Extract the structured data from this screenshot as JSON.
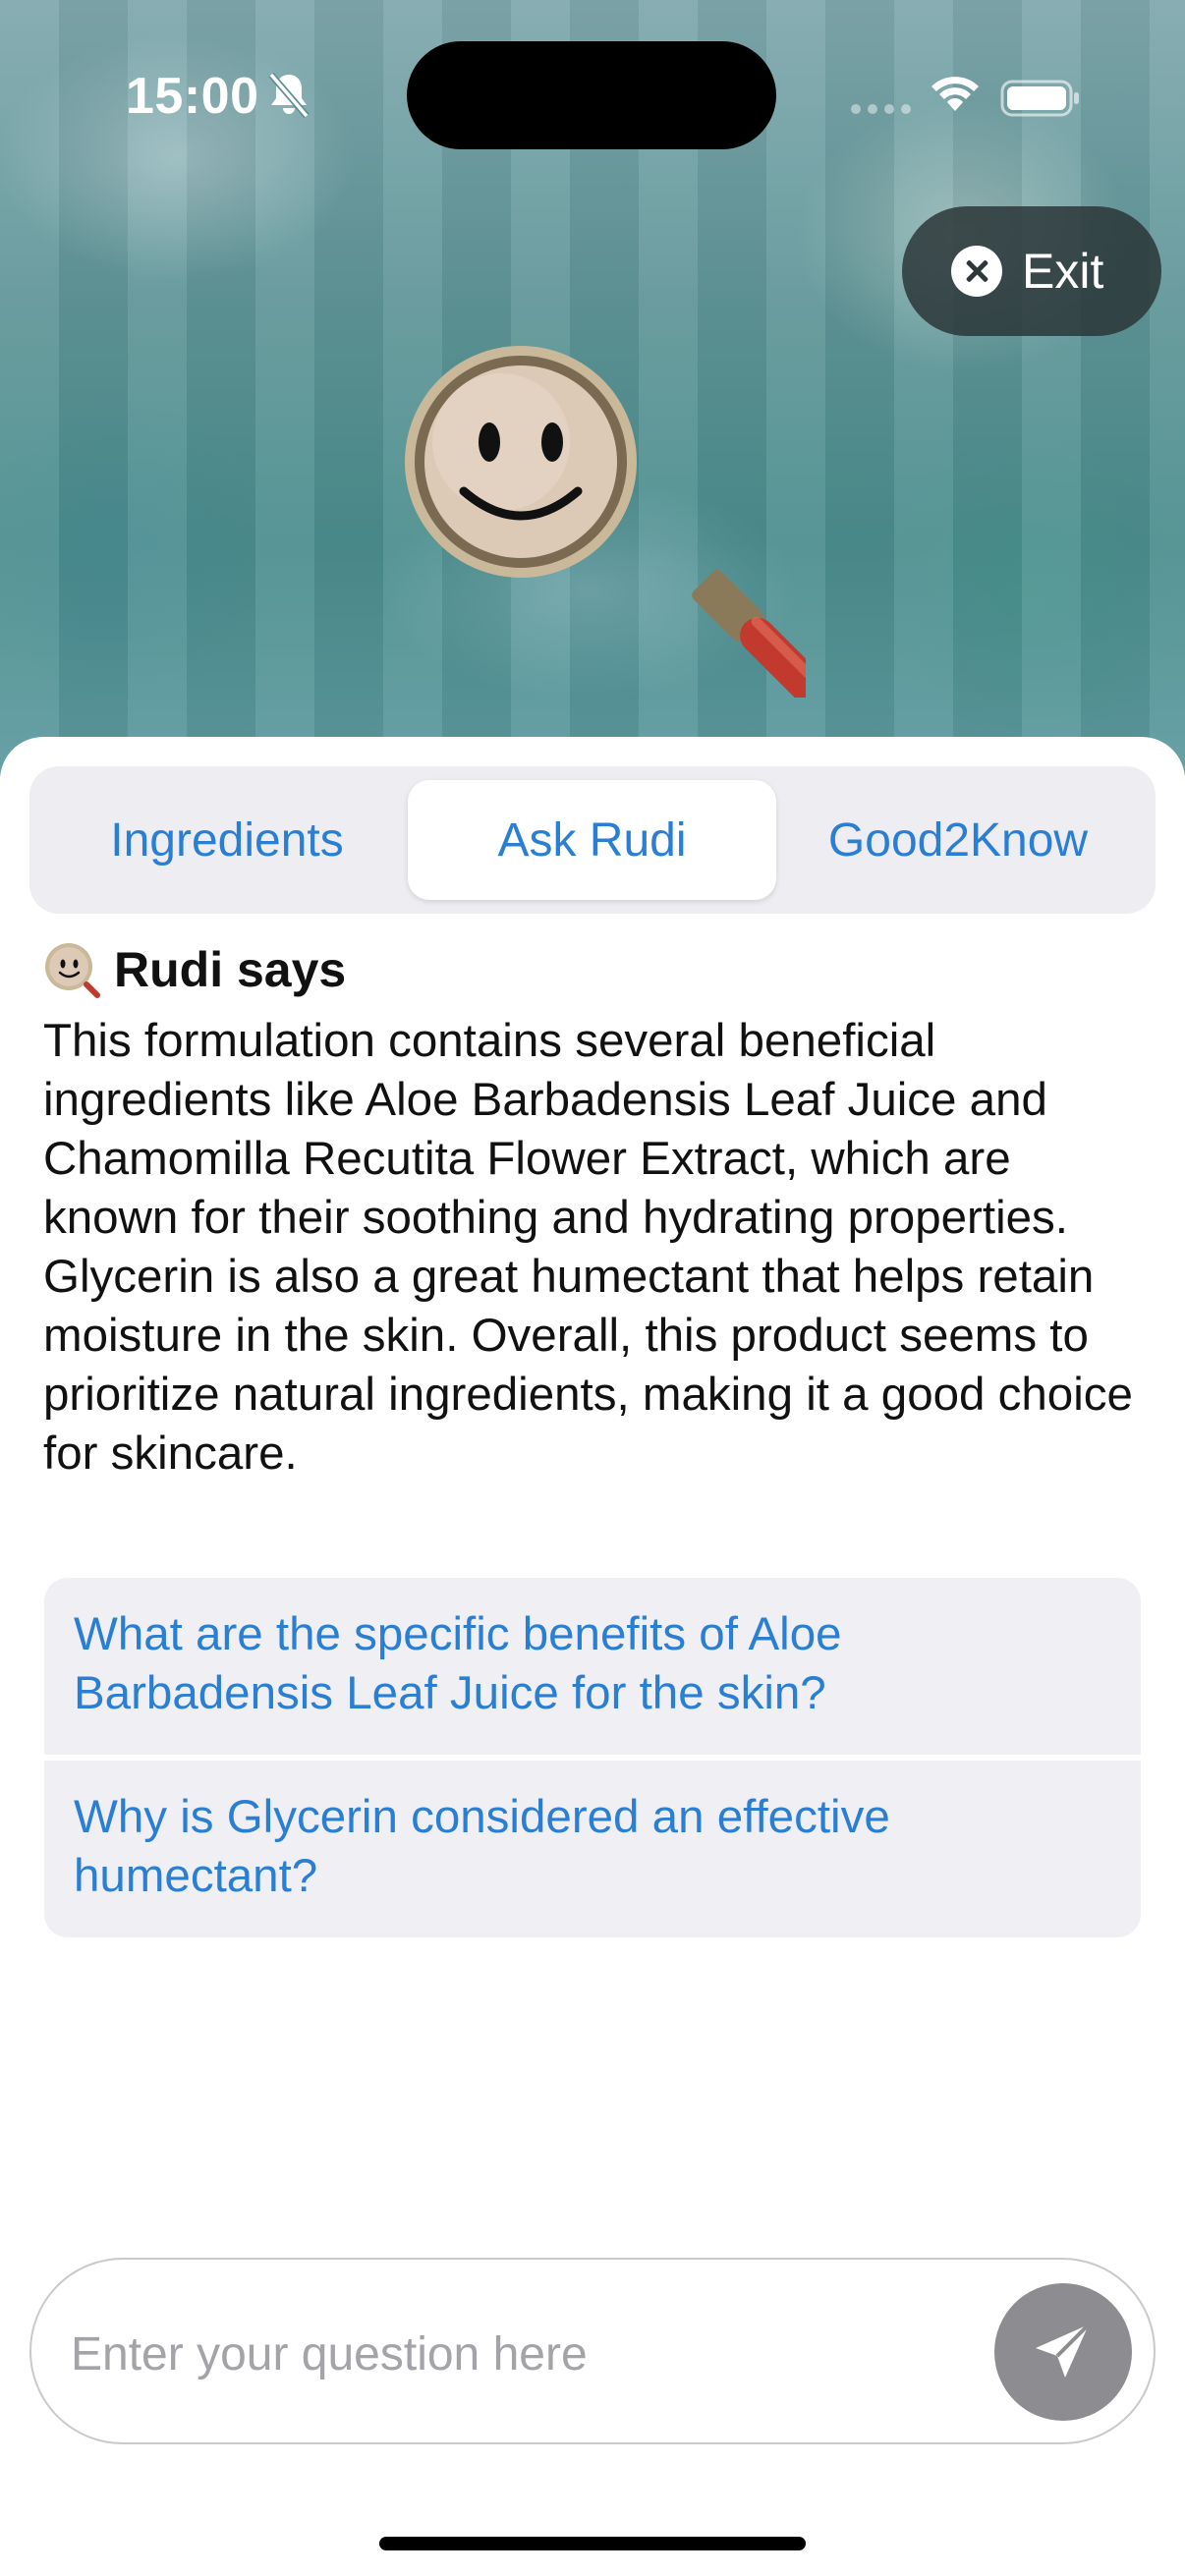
{
  "status_bar": {
    "time": "15:00",
    "icons": [
      "bell-slash-icon",
      "signal-icon",
      "wifi-icon",
      "battery-icon"
    ]
  },
  "header": {
    "exit_label": "Exit",
    "mascot": "magnifying-glass-smiley-mascot"
  },
  "tabs": [
    {
      "label": "Ingredients",
      "selected": false
    },
    {
      "label": "Ask Rudi",
      "selected": true
    },
    {
      "label": "Good2Know",
      "selected": false
    }
  ],
  "chat": {
    "sender_title": "Rudi says",
    "answer": "This formulation contains several beneficial ingredients like Aloe Barbadensis Leaf Juice and Chamomilla Recutita Flower Extract, which are known for their soothing and hydrating properties. Glycerin is also a great humectant that helps retain moisture in the skin. Overall, this product seems to prioritize natural ingredients, making it a good choice for skincare.",
    "suggestions": [
      "What are the specific benefits of Aloe Barbadensis Leaf Juice for the skin?",
      "Why is Glycerin considered an effective humectant?"
    ]
  },
  "input": {
    "placeholder": "Enter your question here",
    "value": ""
  },
  "colors": {
    "accent": "#2a7fd4",
    "send_button": "#8d8d91",
    "segment_bg": "#eeeef2"
  }
}
